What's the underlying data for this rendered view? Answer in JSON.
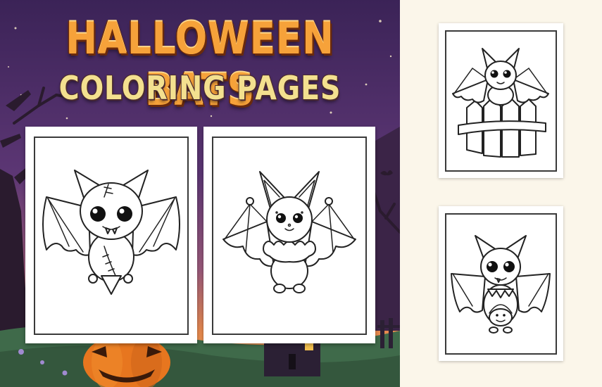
{
  "cover": {
    "title": "HALLOWEEN BATS",
    "subtitle": "COLORING PAGES",
    "colors": {
      "sky_top": "#3b2357",
      "sky_mid": "#6a3f7e",
      "glow": "#e78a4e",
      "ground": "#3f6a4a",
      "title_fill": "#f6a23a",
      "subtitle_fill": "#f3e08f",
      "side_background": "#fbf6ea"
    }
  },
  "pages": [
    {
      "id": "page-1",
      "subject": "bat-with-stitches"
    },
    {
      "id": "page-2",
      "subject": "bat-with-collar"
    },
    {
      "id": "page-3",
      "subject": "bat-on-fence"
    },
    {
      "id": "page-4",
      "subject": "bat-with-pumpkin-basket"
    }
  ]
}
